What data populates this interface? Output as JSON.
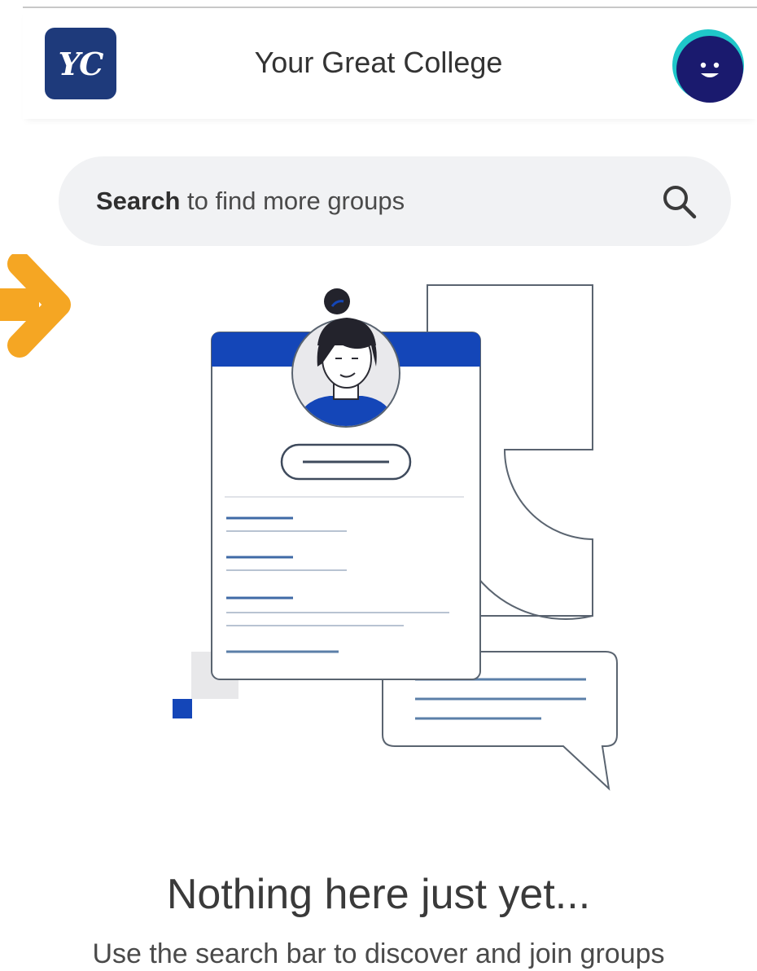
{
  "header": {
    "logo_text": "YC",
    "title": "Your Great College",
    "avatar_icon": "smiley-face-icon",
    "logo_color": "#1e3a7b",
    "avatar_color": "#1a1a6e"
  },
  "search": {
    "bold_label": "Search",
    "rest_label": " to find more groups",
    "icon": "search-icon"
  },
  "callout": {
    "icon": "arrow-right-icon",
    "color": "#f5a623"
  },
  "empty_state": {
    "title": "Nothing here just yet...",
    "subtitle": "Use the search bar to discover and join groups",
    "illustration": "profile-card-illustration",
    "accent_color": "#1446b8"
  }
}
